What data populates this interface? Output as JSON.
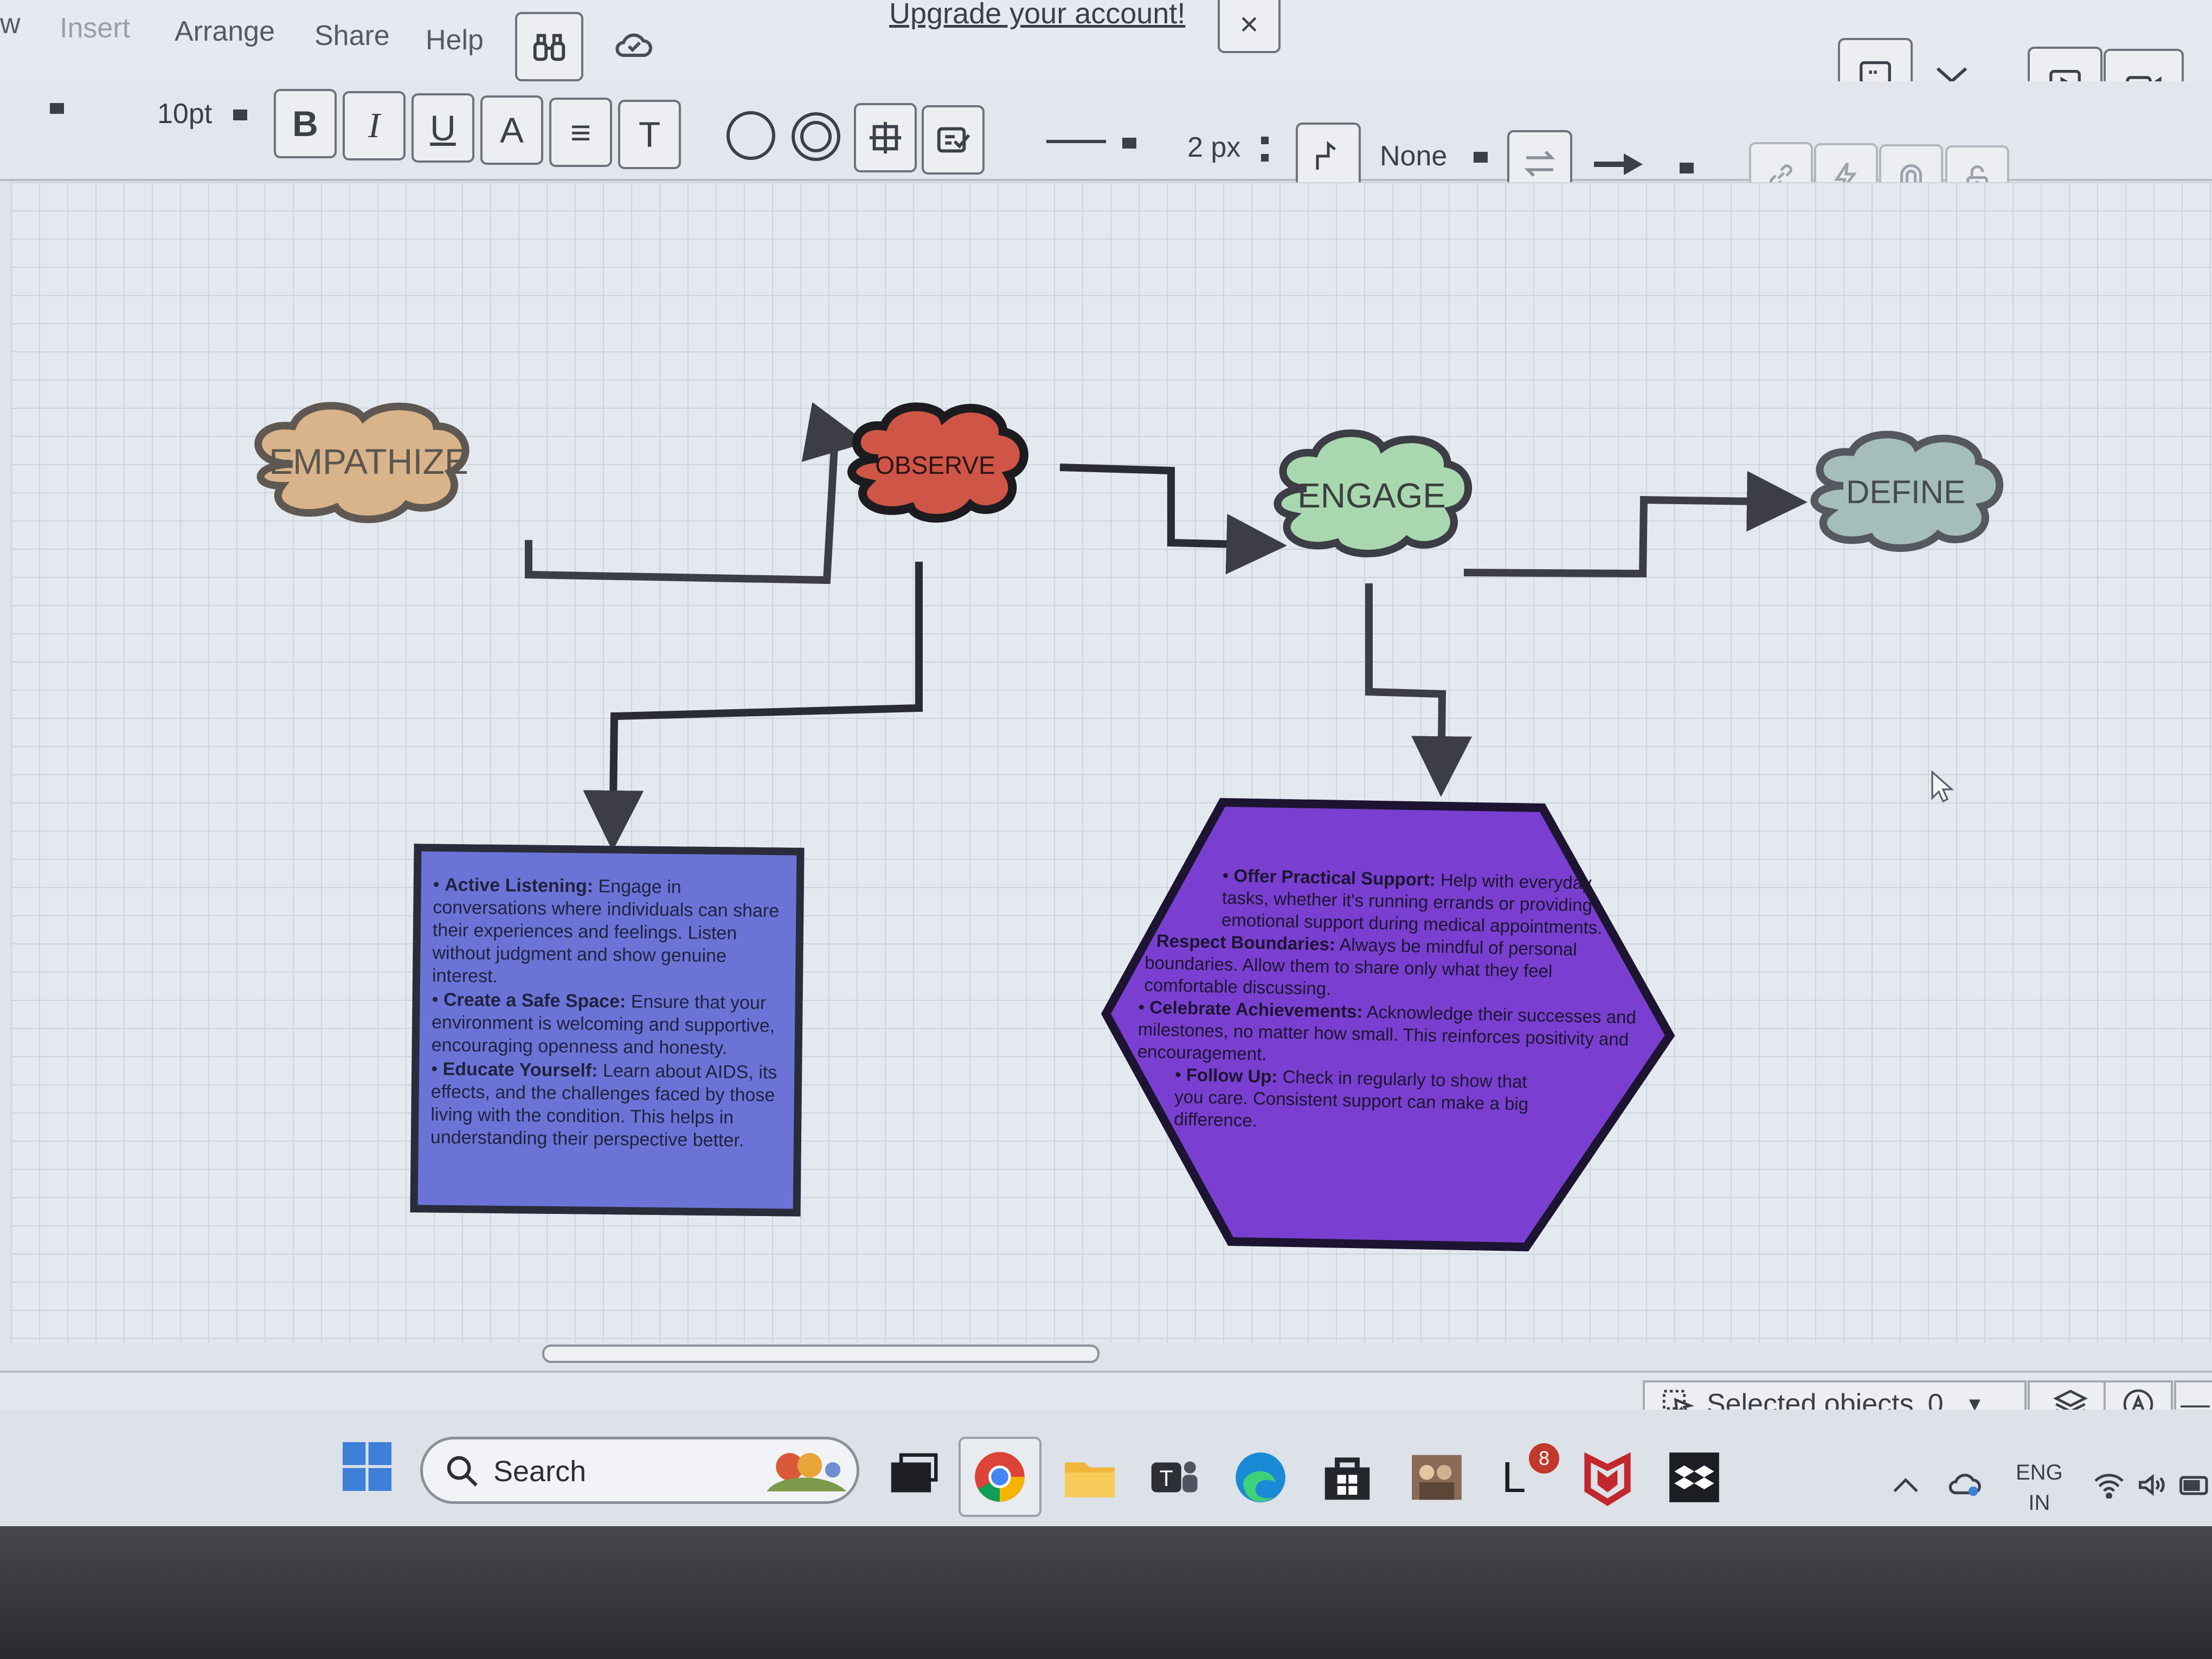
{
  "menubar": {
    "items": [
      "w",
      "Insert",
      "Arrange",
      "Share",
      "Help"
    ],
    "upgrade_link": "Upgrade your account!",
    "close_glyph": "×"
  },
  "toolbar": {
    "font_size": "10pt",
    "bold": "B",
    "italic": "I",
    "underline": "U",
    "font_color": "A",
    "align": "≡",
    "text_size": "T",
    "line_width": "2 px",
    "arrow_start": "None"
  },
  "diagram": {
    "nodes": {
      "empathize": "EMPATHIZE",
      "observe": "OBSERVE",
      "engage": "ENGAGE",
      "define": "DEFINE"
    },
    "colors": {
      "empathize": "#d9b48a",
      "observe": "#cf5547",
      "engage": "#a9d8b0",
      "define": "#a5beba",
      "listening_box": "#6b74d6",
      "support_hex": "#7a3fd0"
    },
    "listening_box": {
      "b1_title": "Active Listening:",
      "b1_text": "Engage in conversations where individuals can share their experiences and feelings. Listen without judgment and show genuine interest.",
      "b2_title": "Create a Safe Space:",
      "b2_text": "Ensure that your environment is welcoming and supportive, encouraging openness and honesty.",
      "b3_title": "Educate Yourself:",
      "b3_text": "Learn about AIDS, its effects, and the challenges faced by those living with the condition. This helps in understanding their perspective better."
    },
    "support_hex": {
      "b1_title": "Offer Practical Support:",
      "b1_text": "Help with everyday tasks, whether it's running errands or providing emotional support during medical appointments.",
      "b2_title": "Respect Boundaries:",
      "b2_text": "Always be mindful of personal boundaries. Allow them to share only what they feel comfortable discussing.",
      "b3_title": "Celebrate Achievements:",
      "b3_text": "Acknowledge their successes and milestones, no matter how small. This reinforces positivity and encouragement.",
      "b4_title": "Follow Up:",
      "b4_text": "Check in regularly to show that you care. Consistent support can make a big difference."
    }
  },
  "statusbar": {
    "selected_objects_label": "Selected objects",
    "selected_objects_count": "0"
  },
  "taskbar": {
    "search_label": "Search",
    "mail_badge": "8",
    "lang_line1": "ENG",
    "lang_line2": "IN"
  }
}
